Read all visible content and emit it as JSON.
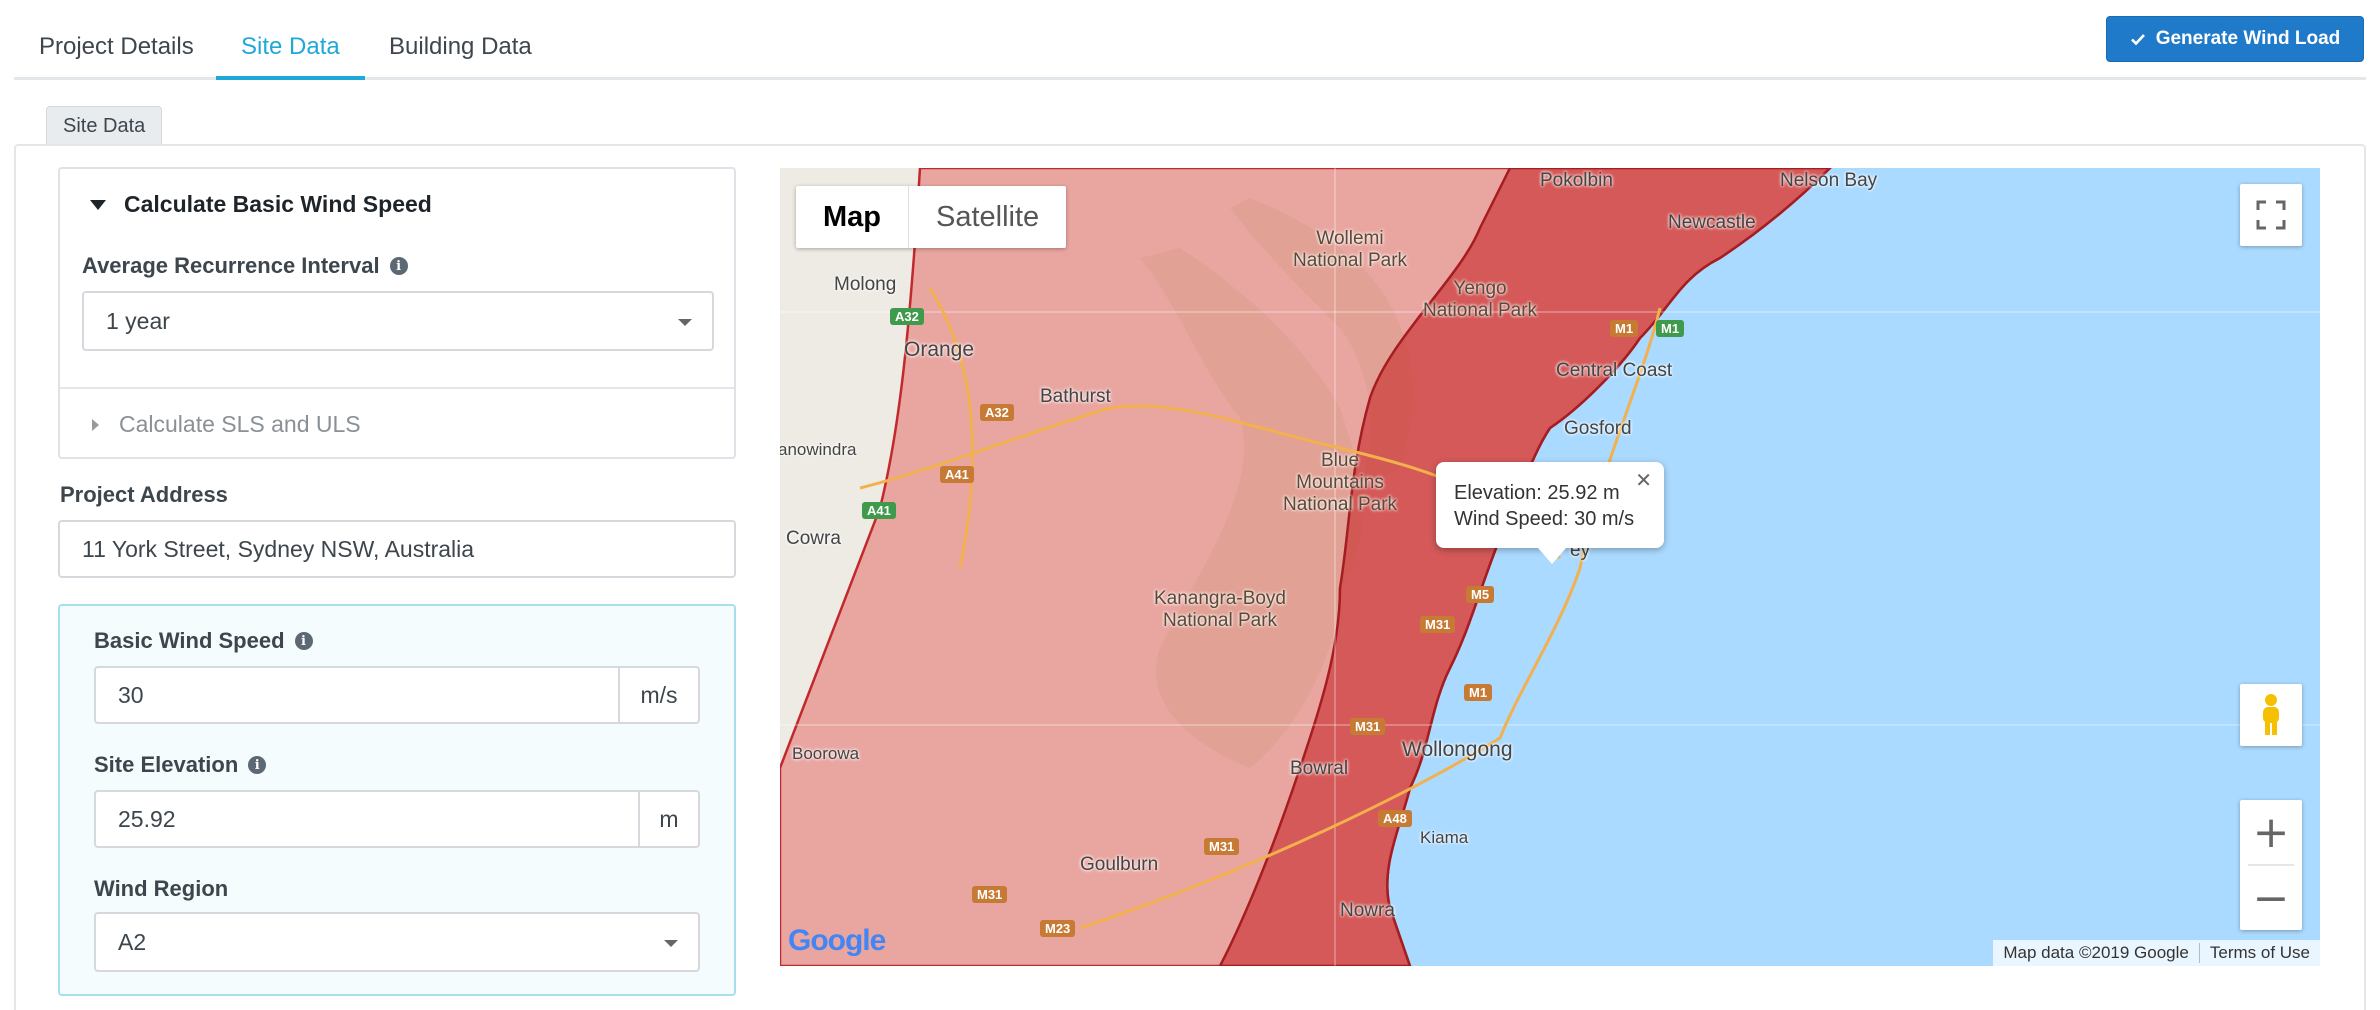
{
  "tabs": [
    {
      "label": "Project Details"
    },
    {
      "label": "Site Data"
    },
    {
      "label": "Building Data"
    }
  ],
  "generate_button": "Generate Wind Load",
  "section_tab": "Site Data",
  "calc_wind": {
    "header": "Calculate Basic Wind Speed",
    "ari_label": "Average Recurrence Interval",
    "ari_value": "1 year",
    "sls_uls_label": "Calculate SLS and ULS"
  },
  "project_address": {
    "label": "Project Address",
    "value": "11 York Street, Sydney NSW, Australia"
  },
  "wind": {
    "speed_label": "Basic Wind Speed",
    "speed_value": "30",
    "speed_unit": "m/s",
    "elevation_label": "Site Elevation",
    "elevation_value": "25.92",
    "elevation_unit": "m",
    "region_label": "Wind Region",
    "region_value": "A2"
  },
  "map": {
    "type_map": "Map",
    "type_satellite": "Satellite",
    "popup_line1": "Elevation: 25.92 m",
    "popup_line2": "Wind Speed: 30 m/s",
    "attribution": "Map data ©2019 Google",
    "terms": "Terms of Use",
    "logo": "Google",
    "places": {
      "pokolbin": "Pokolbin",
      "nelson_bay": "Nelson Bay",
      "newcastle": "Newcastle",
      "wollemi": "Wollemi\nNational Park",
      "yengo": "Yengo\nNational Park",
      "molong": "Molong",
      "orange": "Orange",
      "bathurst": "Bathurst",
      "central_coast": "Central Coast",
      "gosford": "Gosford",
      "canowindra": "anowindra",
      "blue_mountains": "Blue\nMountains\nNational Park",
      "cowra": "Cowra",
      "sydney": "ey",
      "kanangra": "Kanangra-Boyd\nNational Park",
      "boorowa": "Boorowa",
      "wollongong": "Wollongong",
      "bowral": "Bowral",
      "kiama": "Kiama",
      "goulburn": "Goulburn",
      "nowra": "Nowra"
    },
    "roads": [
      "A32",
      "A32",
      "A41",
      "A41",
      "M1",
      "M1",
      "M5",
      "M31",
      "M1",
      "M31",
      "A48",
      "M31",
      "M31",
      "M23"
    ]
  },
  "colors": {
    "accent": "#20a8d8",
    "primary_button": "#1f7ac9",
    "wind_region_fill": "#d94a4a",
    "water": "#aadaff"
  }
}
